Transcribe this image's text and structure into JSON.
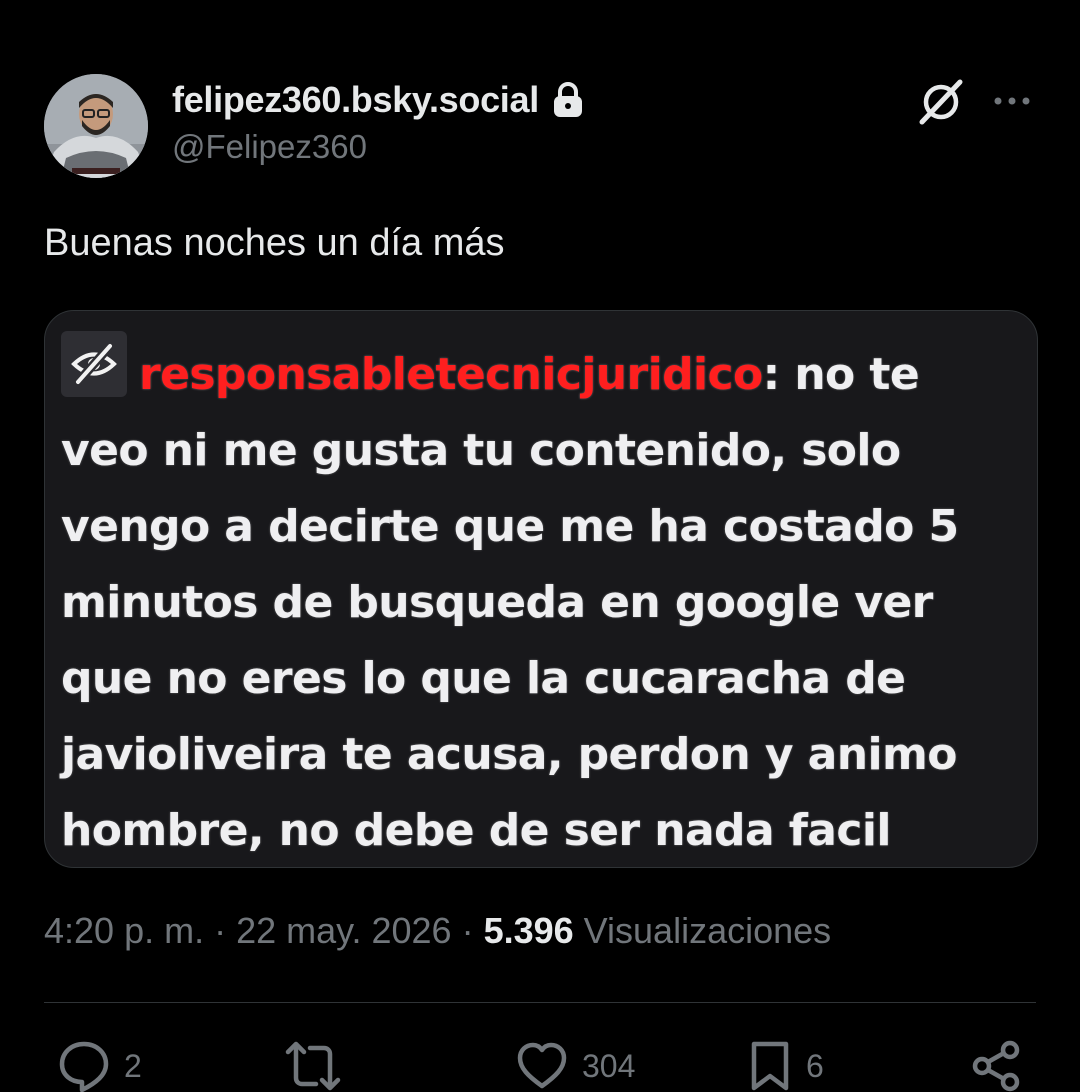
{
  "author": {
    "display_name": "felipez360.bsky.social",
    "handle": "@Felipez360",
    "verified_icon": "lock-icon",
    "avatar": "avatar-photo"
  },
  "header_icons": [
    "grok-icon",
    "more-icon"
  ],
  "tweet": {
    "text": "Buenas noches un día más"
  },
  "media": {
    "badge_icon": "eye-slash-icon",
    "username": "responsabletecnicjuridico",
    "separator": ":",
    "message": " no te veo ni me gusta tu contenido, solo vengo a decirte que me ha costado 5 minutos de busqueda en google ver que no eres lo que la cucaracha de javioliveira te acusa, perdon y animo hombre, no debe de ser nada facil",
    "username_color": "#ff1f1f"
  },
  "meta": {
    "time": "4:20 p. m.",
    "dot1": " · ",
    "date": "22 may. 2026",
    "dot2": " · ",
    "views_count": "5.396",
    "views_label": " Visualizaciones"
  },
  "actions": {
    "replies": "2",
    "retweets": "",
    "likes": "304",
    "bookmarks": "6"
  },
  "colors": {
    "background": "#000000",
    "text": "#e7e9ea",
    "muted": "#71767b",
    "border": "#2f3336"
  }
}
